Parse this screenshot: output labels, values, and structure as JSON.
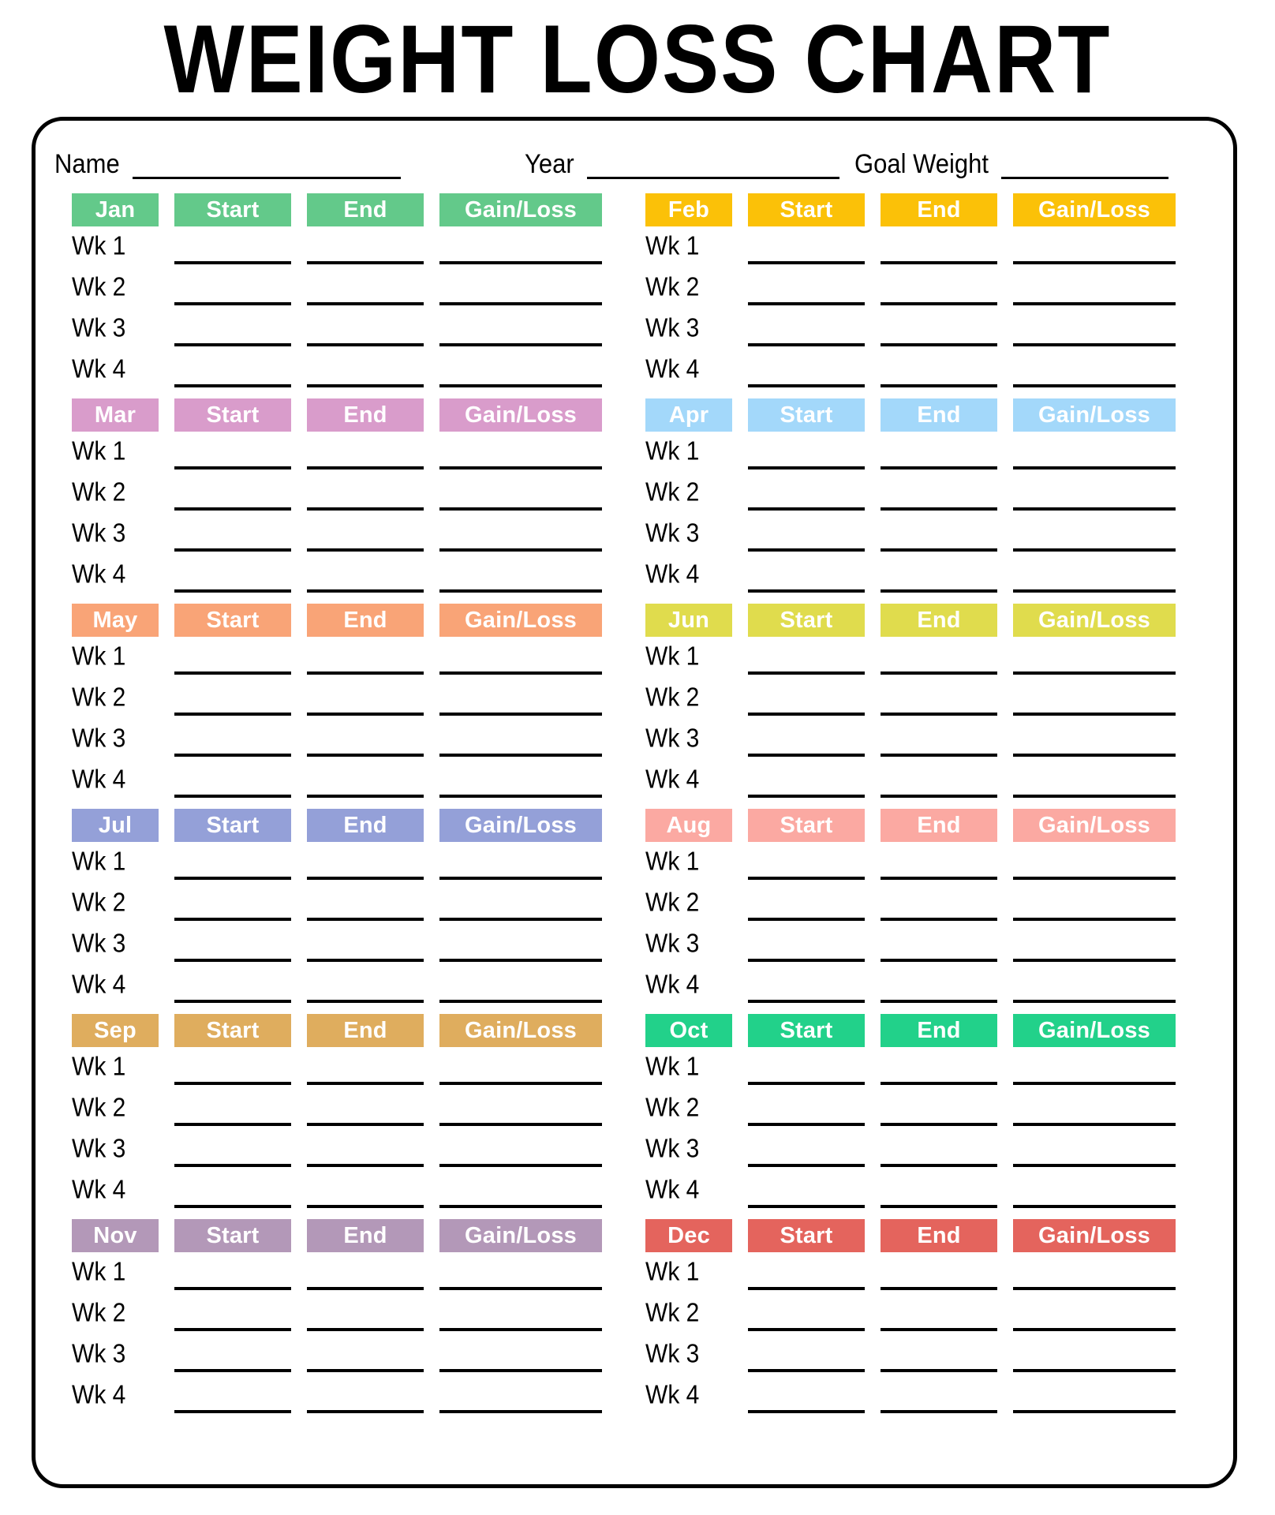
{
  "title": "WEIGHT LOSS CHART",
  "identity": [
    {
      "label": "Name",
      "name": "name-field"
    },
    {
      "label": "Year",
      "name": "year-field"
    },
    {
      "label": "Goal Weight",
      "name": "goal-weight-field"
    }
  ],
  "columns": {
    "start": "Start",
    "end": "End",
    "gain_loss": "Gain/Loss"
  },
  "weeks": [
    "Wk 1",
    "Wk 2",
    "Wk 3",
    "Wk 4"
  ],
  "months": [
    {
      "label": "Jan",
      "color": "#63c98a"
    },
    {
      "label": "Feb",
      "color": "#fbc108"
    },
    {
      "label": "Mar",
      "color": "#d99ccb"
    },
    {
      "label": "Apr",
      "color": "#a3d8fa"
    },
    {
      "label": "May",
      "color": "#f9a477"
    },
    {
      "label": "Jun",
      "color": "#e0dc4d"
    },
    {
      "label": "Jul",
      "color": "#94a0d8"
    },
    {
      "label": "Aug",
      "color": "#fba9a2"
    },
    {
      "label": "Sep",
      "color": "#dfad5e"
    },
    {
      "label": "Oct",
      "color": "#22d18a"
    },
    {
      "label": "Nov",
      "color": "#b398b8"
    },
    {
      "label": "Dec",
      "color": "#e4645d"
    }
  ]
}
